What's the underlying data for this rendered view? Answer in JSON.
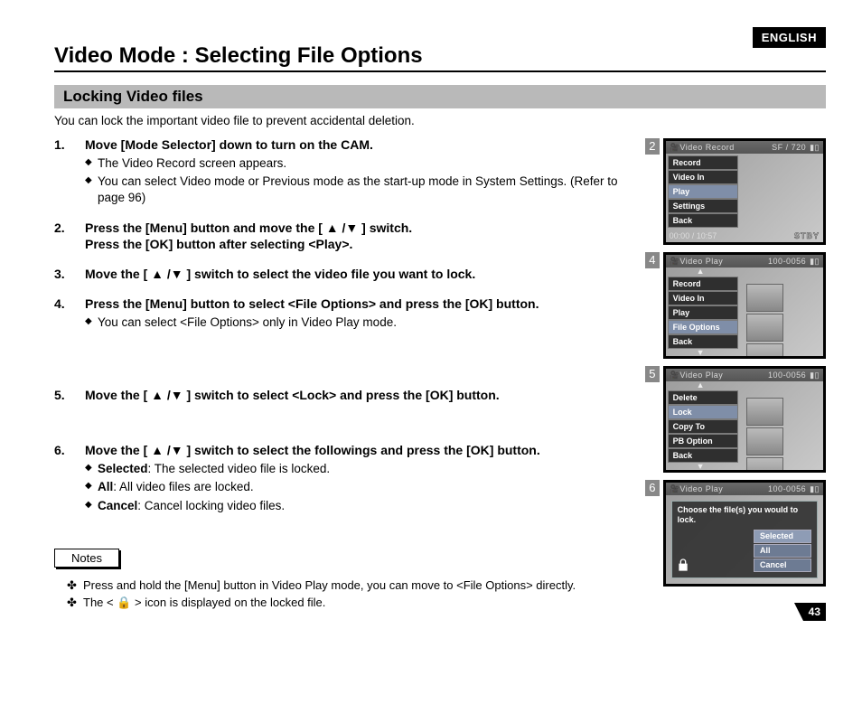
{
  "lang_tag": "ENGLISH",
  "page_title": "Video Mode : Selecting File Options",
  "section_title": "Locking Video files",
  "intro": "You can lock the important video file to prevent accidental deletion.",
  "steps": [
    {
      "title": "Move [Mode Selector] down to turn on the CAM.",
      "sub": [
        "The Video Record screen appears.",
        "You can select Video mode or Previous mode as the start-up mode in System Settings. (Refer to page 96)"
      ]
    },
    {
      "title": "Press the [Menu] button and move the [ ▲ /▼ ] switch.",
      "title_extra": "Press the [OK] button after selecting <Play>.",
      "sub": []
    },
    {
      "title": "Move the [ ▲ /▼ ] switch to select the video file you want to lock.",
      "sub": []
    },
    {
      "title": "Press the [Menu] button to select <File Options> and press the [OK] button.",
      "sub": [
        "You can select <File Options> only in Video Play mode."
      ]
    },
    {
      "title": "Move the [ ▲ /▼ ] switch to select <Lock> and press the [OK] button.",
      "sub": []
    },
    {
      "title": "Move the [ ▲ /▼ ] switch to select the followings and press the [OK] button.",
      "sub_rich": [
        {
          "b": "Selected",
          "rest": ": The selected video file is locked."
        },
        {
          "b": "All",
          "rest": ": All video files are locked."
        },
        {
          "b": "Cancel",
          "rest": ": Cancel locking video files."
        }
      ]
    }
  ],
  "notes_label": "Notes",
  "notes": [
    "Press and hold the [Menu] button in Video Play mode, you can move to <File Options> directly.",
    "The <  🔒  > icon is displayed on the locked file."
  ],
  "page_number": "43",
  "screens": {
    "s2": {
      "num": "2",
      "title": "Video Record",
      "badge": "SF  /  720",
      "timer": "00:00 / 10:57",
      "state": "STBY",
      "menu": [
        "Record",
        "Video In",
        "Play",
        "Settings",
        "Back"
      ],
      "selected": "Play"
    },
    "s4": {
      "num": "4",
      "title": "Video Play",
      "counter": "100-0056",
      "menu": [
        "Record",
        "Video In",
        "Play",
        "File Options",
        "Back"
      ],
      "selected": "File Options"
    },
    "s5": {
      "num": "5",
      "title": "Video Play",
      "counter": "100-0056",
      "menu": [
        "Delete",
        "Lock",
        "Copy To",
        "PB Option",
        "Back"
      ],
      "selected": "Lock"
    },
    "s6": {
      "num": "6",
      "title": "Video Play",
      "counter": "100-0056",
      "dialog_text": "Choose the file(s) you would to lock.",
      "options": [
        "Selected",
        "All",
        "Cancel"
      ],
      "selected": "Selected"
    }
  }
}
